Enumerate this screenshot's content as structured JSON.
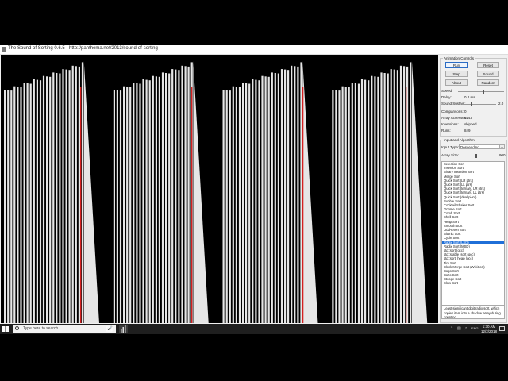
{
  "window": {
    "title": "The Sound of Sorting 0.6.5 - http://panthema.net/2013/sound-of-sorting"
  },
  "animation_controls": {
    "group_title": "Animation Controls",
    "buttons": {
      "run": "Run",
      "reset": "Reset",
      "step": "Step",
      "sound": "Sound",
      "about": "About",
      "random": "Random"
    },
    "speed_label": "Speed:",
    "delay_label": "Delay:",
    "delay_value": "0.2 ms",
    "sound_sustain_label": "Sound Sustain:",
    "sound_sustain_value": "2.0",
    "comparisons_label": "Comparisons:",
    "comparisons_value": "0",
    "array_accesses_label": "Array Accesses:",
    "array_accesses_value": "9143",
    "inversions_label": "Inversions:",
    "inversions_value": "skipped",
    "runs_label": "Runs:",
    "runs_value": "849"
  },
  "input_algorithm": {
    "group_title": "Input and Algorithm",
    "input_type_label": "Input Type:",
    "input_type_value": "Descending",
    "array_size_label": "Array Size:",
    "array_size_value": "900",
    "algorithms": [
      "Selection Sort",
      "Insertion Sort",
      "Binary Insertion Sort",
      "Merge Sort",
      "Quick Sort (LR ptrs)",
      "Quick Sort (LL ptrs)",
      "Quick Sort (ternary, LR ptrs)",
      "Quick Sort (ternary, LL ptrs)",
      "Quick Sort (dual pivot)",
      "Bubble Sort",
      "Cocktail Shaker Sort",
      "Gnome Sort",
      "Comb Sort",
      "Shell Sort",
      "Heap Sort",
      "Smooth Sort",
      "Odd-Even Sort",
      "Bitonic Sort",
      "Cycle Sort",
      "Radix Sort (LSD)",
      "Radix Sort (MSD)",
      "std::sort (gcc)",
      "std::stable_sort (gcc)",
      "std::sort_heap (gcc)",
      "Tim Sort",
      "Block Merge Sort (WikiSort)",
      "Bogo Sort",
      "Bozo Sort",
      "Stooge Sort",
      "Slow Sort"
    ],
    "selected_index": 19,
    "description": "Least significant digit radix sort, which copies item into a shadow array during counting."
  },
  "taskbar": {
    "search_placeholder": "Type here to search",
    "time": "1:30 AM",
    "date": "12/2/2018"
  },
  "colors": {
    "bar": "#e6e6e6",
    "highlight": "#d42020",
    "selection": "#1f6fd8"
  },
  "visualization": {
    "segment_count": 4,
    "bars_per_segment": 25,
    "highlight_positions": [
      100,
      240,
      380,
      510
    ]
  }
}
